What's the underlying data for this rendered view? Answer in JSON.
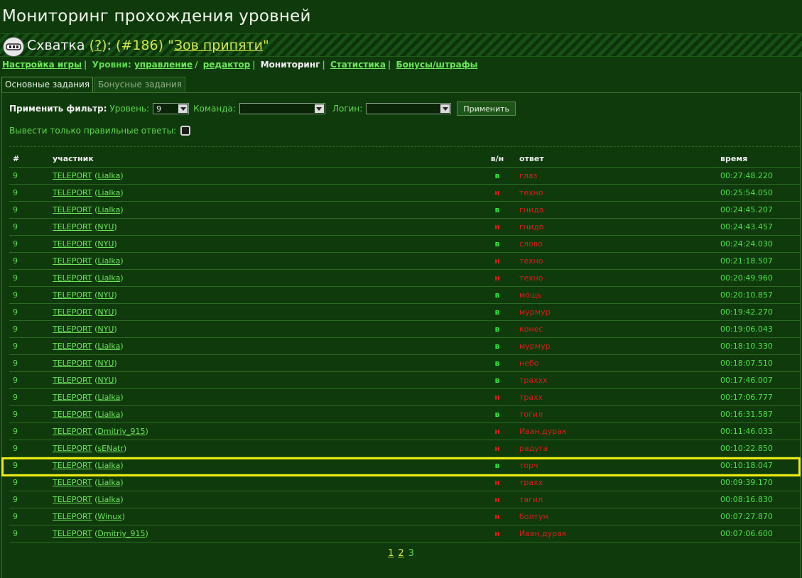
{
  "page_title": "Мониторинг прохождения уровней",
  "game": {
    "prefix": "Схватка",
    "help": "?",
    "number": "#186",
    "name": "Зов припяти"
  },
  "nav": {
    "settings": "Настройка игры",
    "levels_label": "Уровни:",
    "manage": "управление",
    "editor": "редактор",
    "monitoring": "Мониторинг",
    "stats": "Статистика",
    "bonuses": "Бонусы/штрафы"
  },
  "tabs": [
    "Основные задания",
    "Бонусные задания"
  ],
  "filter": {
    "title": "Применить фильтр:",
    "level_label": "Уровень:",
    "level_value": "9",
    "team_label": "Команда:",
    "team_value": "",
    "login_label": "Логин:",
    "login_value": "",
    "apply": "Применить",
    "correct_only": "Вывести только правильные ответы:"
  },
  "table": {
    "headers": [
      "#",
      "участник",
      "в/н",
      "ответ",
      "время"
    ],
    "rows": [
      {
        "num": "9",
        "team": "TELEPORT",
        "user": "Lialka",
        "vn": "в",
        "ok": true,
        "answer": "глаз",
        "time": "00:27:48.220"
      },
      {
        "num": "9",
        "team": "TELEPORT",
        "user": "Lialka",
        "vn": "н",
        "ok": false,
        "answer": "техно",
        "time": "00:25:54.050"
      },
      {
        "num": "9",
        "team": "TELEPORT",
        "user": "Lialka",
        "vn": "в",
        "ok": true,
        "answer": "гнида",
        "time": "00:24:45.207"
      },
      {
        "num": "9",
        "team": "TELEPORT",
        "user": "NYU",
        "vn": "н",
        "ok": false,
        "answer": "гнидо",
        "time": "00:24:43.457"
      },
      {
        "num": "9",
        "team": "TELEPORT",
        "user": "NYU",
        "vn": "в",
        "ok": true,
        "answer": "слово",
        "time": "00:24:24.030"
      },
      {
        "num": "9",
        "team": "TELEPORT",
        "user": "Lialka",
        "vn": "н",
        "ok": false,
        "answer": "техно",
        "time": "00:21:18.507"
      },
      {
        "num": "9",
        "team": "TELEPORT",
        "user": "Lialka",
        "vn": "н",
        "ok": false,
        "answer": "техно",
        "time": "00:20:49.960"
      },
      {
        "num": "9",
        "team": "TELEPORT",
        "user": "NYU",
        "vn": "в",
        "ok": true,
        "answer": "мощь",
        "time": "00:20:10.857"
      },
      {
        "num": "9",
        "team": "TELEPORT",
        "user": "NYU",
        "vn": "в",
        "ok": true,
        "answer": "мурмур",
        "time": "00:19:42.270"
      },
      {
        "num": "9",
        "team": "TELEPORT",
        "user": "NYU",
        "vn": "в",
        "ok": true,
        "answer": "конес",
        "time": "00:19:06.043"
      },
      {
        "num": "9",
        "team": "TELEPORT",
        "user": "Lialka",
        "vn": "в",
        "ok": true,
        "answer": "мурмур",
        "time": "00:18:10.330"
      },
      {
        "num": "9",
        "team": "TELEPORT",
        "user": "NYU",
        "vn": "в",
        "ok": true,
        "answer": "небо",
        "time": "00:18:07.510"
      },
      {
        "num": "9",
        "team": "TELEPORT",
        "user": "NYU",
        "vn": "в",
        "ok": true,
        "answer": "траххх",
        "time": "00:17:46.007"
      },
      {
        "num": "9",
        "team": "TELEPORT",
        "user": "Lialka",
        "vn": "н",
        "ok": false,
        "answer": "трахх",
        "time": "00:17:06.777"
      },
      {
        "num": "9",
        "team": "TELEPORT",
        "user": "Lialka",
        "vn": "в",
        "ok": true,
        "answer": "тогил",
        "time": "00:16:31.587"
      },
      {
        "num": "9",
        "team": "TELEPORT",
        "user": "Dmitriy_915",
        "vn": "н",
        "ok": false,
        "answer": "Иван,дурак",
        "time": "00:11:46.033"
      },
      {
        "num": "9",
        "team": "TELEPORT",
        "user": "sENatr",
        "vn": "н",
        "ok": false,
        "answer": "радуга",
        "time": "00:10:22.850"
      },
      {
        "num": "9",
        "team": "TELEPORT",
        "user": "Lialka",
        "vn": "в",
        "ok": true,
        "answer": "торч",
        "time": "00:10:18.047",
        "highlight": true
      },
      {
        "num": "9",
        "team": "TELEPORT",
        "user": "Lialka",
        "vn": "н",
        "ok": false,
        "answer": "трахх",
        "time": "00:09:39.170"
      },
      {
        "num": "9",
        "team": "TELEPORT",
        "user": "Lialka",
        "vn": "н",
        "ok": false,
        "answer": "тагил",
        "time": "00:08:16.830"
      },
      {
        "num": "9",
        "team": "TELEPORT",
        "user": "Winux",
        "vn": "н",
        "ok": false,
        "answer": "болтун",
        "time": "00:07:27.870"
      },
      {
        "num": "9",
        "team": "TELEPORT",
        "user": "Dmitriy_915",
        "vn": "н",
        "ok": false,
        "answer": "Иван,дурак",
        "time": "00:07:06.600"
      }
    ]
  },
  "pager": {
    "pages": [
      "1",
      "2",
      "3"
    ],
    "current": "3"
  },
  "colors": {
    "background": "#0f3a0c",
    "link": "#6de85a",
    "correct": "#31e83a",
    "wrong": "#e02020",
    "highlight": "#f2ea10"
  }
}
